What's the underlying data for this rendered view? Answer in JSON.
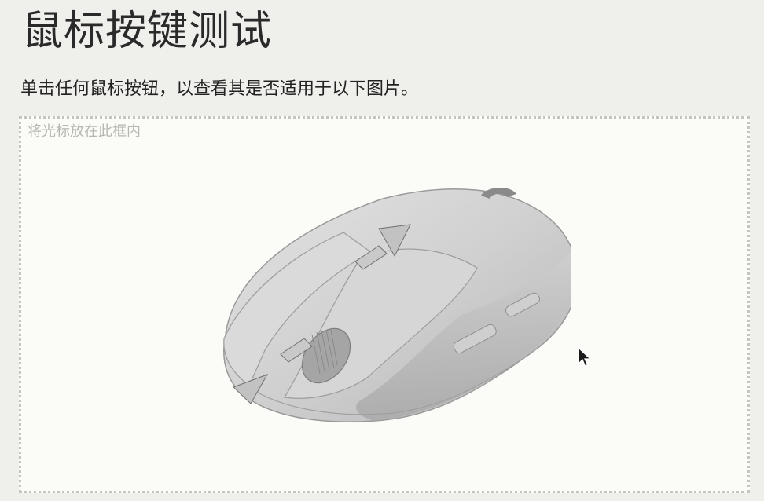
{
  "header": {
    "title": "鼠标按键测试",
    "instruction": "单击任何鼠标按钮，以查看其是否适用于以下图片。"
  },
  "test_area": {
    "hint": "将光标放在此框内",
    "mouse_image": "mouse-illustration",
    "cursor_icon": "pointer-cursor-icon"
  }
}
